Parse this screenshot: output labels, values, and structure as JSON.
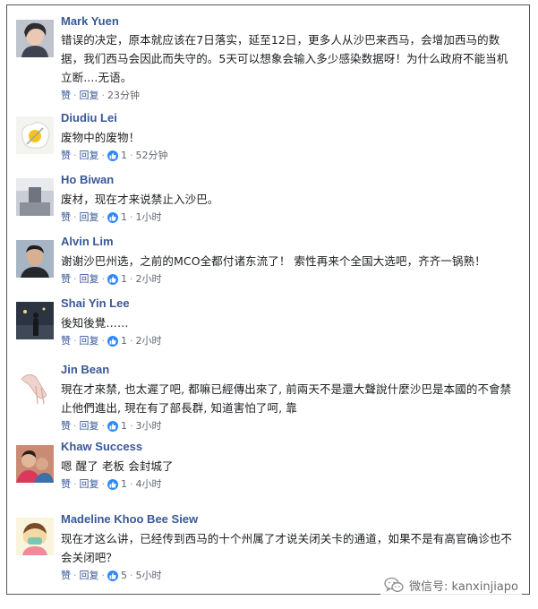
{
  "comments": [
    {
      "name": "Mark Yuen",
      "text": "错误的决定，原本就应该在7日落实，延至12日，更多人从沙巴来西马，会增加西马的数据，我们西马会因此而失守的。5天可以想象会输入多少感染数据呀！为什么政府不能当机立断....无语。",
      "like": "赞",
      "reply": "回复",
      "likes": "",
      "time": "23分钟"
    },
    {
      "name": "Diudiu Lei",
      "text": "废物中的废物！",
      "like": "赞",
      "reply": "回复",
      "likes": "1",
      "time": "52分钟"
    },
    {
      "name": "Ho Biwan",
      "text": "废材，现在才来说禁止入沙巴。",
      "like": "赞",
      "reply": "回复",
      "likes": "1",
      "time": "1小时"
    },
    {
      "name": "Alvin Lim",
      "text": "谢谢沙巴州选，之前的MCO全都付诸东流了！ 索性再来个全国大选吧，齐齐一锅熟！",
      "like": "赞",
      "reply": "回复",
      "likes": "1",
      "time": "2小时"
    },
    {
      "name": "Shai Yin Lee",
      "text": "後知後覺……",
      "like": "赞",
      "reply": "回复",
      "likes": "1",
      "time": "2小时"
    },
    {
      "name": "Jin Bean",
      "text": "現在才來禁, 也太遲了吧, 都嘛已經傳出來了, 前兩天不是還大聲說什麼沙巴是本國的不會禁止他們進出, 現在有了部長群, 知道害怕了呵, 靠",
      "like": "赞",
      "reply": "回复",
      "likes": "1",
      "time": "3小时"
    },
    {
      "name": "Khaw Success",
      "text": "嗯 醒了 老板 会封城了",
      "like": "赞",
      "reply": "回复",
      "likes": "1",
      "time": "4小时"
    },
    {
      "name": "Madeline Khoo Bee Siew",
      "text": "现在才这么讲，已经传到西马的十个州属了才说关闭关卡的通道，如果不是有高官确诊也不会关闭吧？",
      "like": "赞",
      "reply": "回复",
      "likes": "5",
      "time": "5小时"
    }
  ],
  "watermark": {
    "label": "微信号: kanxinjiapo",
    "icon": "wechat-icon"
  },
  "colors": {
    "name": "#385898",
    "text": "#1c1e21",
    "meta": "#616770",
    "like_badge": "#2d88ff",
    "border": "#555555"
  }
}
